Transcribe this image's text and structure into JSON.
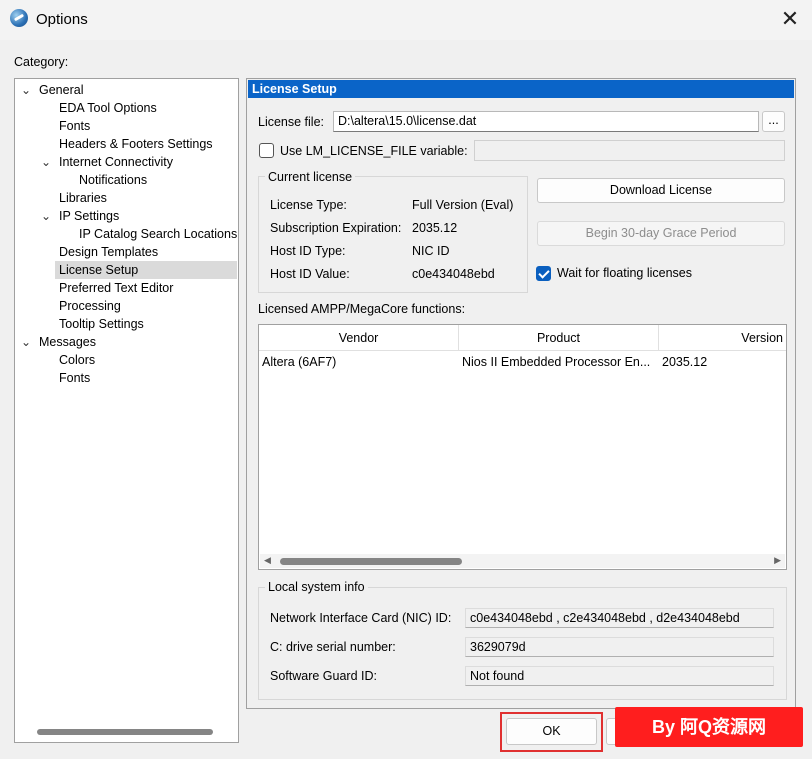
{
  "window": {
    "title": "Options",
    "close_glyph": "✕"
  },
  "category": {
    "label": "Category:",
    "tree": [
      {
        "label": "General",
        "level": 0,
        "chevron": "⌄"
      },
      {
        "label": "EDA Tool Options",
        "level": 1
      },
      {
        "label": "Fonts",
        "level": 1
      },
      {
        "label": "Headers & Footers Settings",
        "level": 1
      },
      {
        "label": "Internet Connectivity",
        "level": 1,
        "chevron": "⌄"
      },
      {
        "label": "Notifications",
        "level": 2
      },
      {
        "label": "Libraries",
        "level": 1
      },
      {
        "label": "IP Settings",
        "level": 1,
        "chevron": "⌄"
      },
      {
        "label": "IP Catalog Search Locations",
        "level": 2
      },
      {
        "label": "Design Templates",
        "level": 1
      },
      {
        "label": "License Setup",
        "level": 1,
        "selected": true
      },
      {
        "label": "Preferred Text Editor",
        "level": 1
      },
      {
        "label": "Processing",
        "level": 1
      },
      {
        "label": "Tooltip Settings",
        "level": 1
      },
      {
        "label": "Messages",
        "level": 0,
        "chevron": "⌄"
      },
      {
        "label": "Colors",
        "level": 1
      },
      {
        "label": "Fonts",
        "level": 1
      }
    ]
  },
  "license": {
    "header": "License Setup",
    "file_label": "License file:",
    "file_value": "D:\\altera\\15.0\\license.dat",
    "browse_label": "...",
    "use_env_label": "Use LM_LICENSE_FILE variable:",
    "use_env_checked": false,
    "current_title": "Current license",
    "rows": [
      {
        "label": "License Type:",
        "value": "Full Version (Eval)"
      },
      {
        "label": "Subscription Expiration:",
        "value": "2035.12"
      },
      {
        "label": "Host ID Type:",
        "value": "NIC ID"
      },
      {
        "label": "Host ID Value:",
        "value": "c0e434048ebd"
      }
    ],
    "download_label": "Download License",
    "grace_label": "Begin 30-day Grace Period",
    "wait_label": "Wait for floating licenses",
    "wait_checked": true,
    "functions_label": "Licensed AMPP/MegaCore functions:",
    "table": {
      "columns": [
        "Vendor",
        "Product",
        "Version"
      ],
      "rows": [
        [
          "Altera (6AF7)",
          "Nios II Embedded Processor En...",
          "2035.12"
        ]
      ]
    },
    "local_title": "Local system info",
    "local_rows": [
      {
        "label": "Network Interface Card (NIC) ID:",
        "value": "c0e434048ebd , c2e434048ebd , d2e434048ebd"
      },
      {
        "label": "C: drive serial number:",
        "value": "3629079d"
      },
      {
        "label": "Software Guard ID:",
        "value": "Not found"
      }
    ]
  },
  "buttons": {
    "ok": "OK"
  },
  "watermark": "By 阿Q资源网"
}
